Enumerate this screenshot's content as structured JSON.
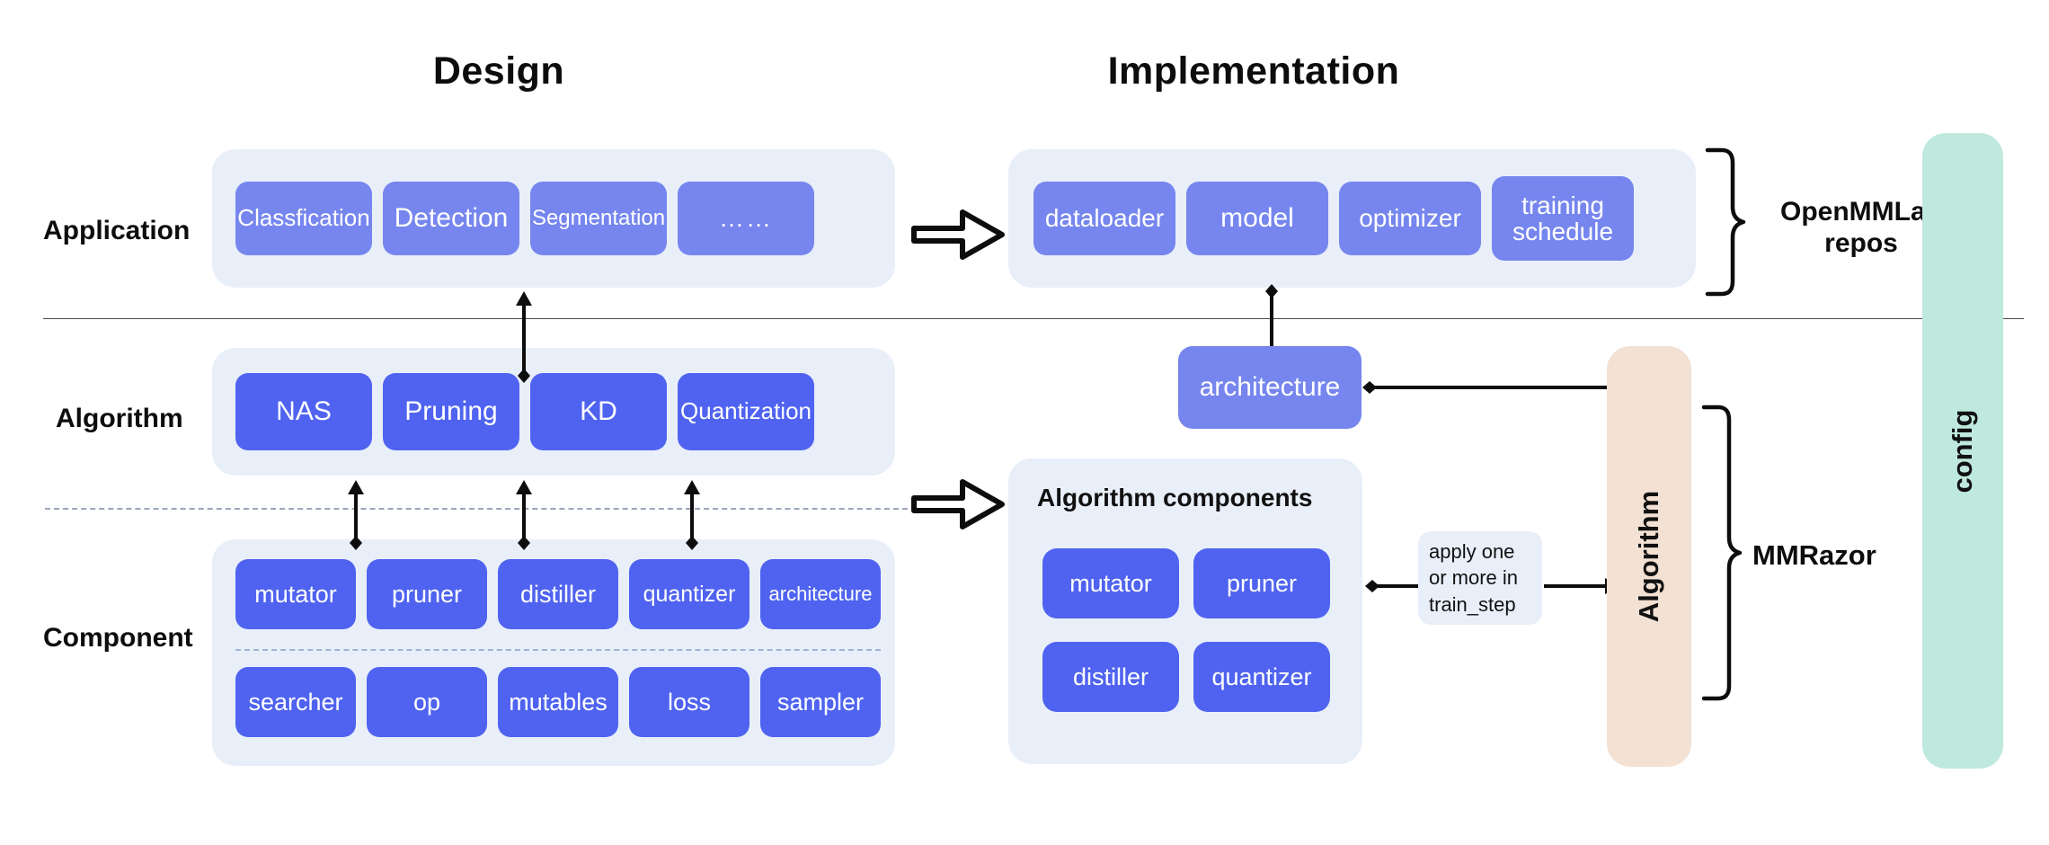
{
  "headings": {
    "design": "Design",
    "implementation": "Implementation"
  },
  "rows": {
    "application": "Application",
    "algorithm": "Algorithm",
    "component": "Component"
  },
  "design": {
    "application_items": [
      "Classfication",
      "Detection",
      "Segmentation",
      "……"
    ],
    "algorithm_items": [
      "NAS",
      "Pruning",
      "KD",
      "Quantization"
    ],
    "component_items_row1": [
      "mutator",
      "pruner",
      "distiller",
      "quantizer",
      "architecture"
    ],
    "component_items_row2": [
      "searcher",
      "op",
      "mutables",
      "loss",
      "sampler"
    ]
  },
  "implementation": {
    "application_items": [
      "dataloader",
      "model",
      "optimizer",
      "training schedule"
    ],
    "architecture_label": "architecture",
    "components_panel_title": "Algorithm components",
    "component_items": [
      "mutator",
      "pruner",
      "distiller",
      "quantizer"
    ],
    "apply_note": "apply one or more in train_step",
    "apply_note_lines": [
      "apply one",
      "or more in",
      "train_step"
    ]
  },
  "annotations": {
    "openmmlab_repos": "OpenMMLab repos",
    "openmmlab_repos_lines": [
      "OpenMMLab",
      "repos"
    ],
    "mmrazor": "MMRazor",
    "algorithm_bar": "Algorithm",
    "config_bar": "config"
  },
  "colors": {
    "chip_light": "#7686ee",
    "chip_dark": "#4f63f0",
    "panel_bg": "#e9eff9",
    "algorithm_bar_bg": "#f3e1d3",
    "config_bar_bg": "#bfe9de",
    "line": "#4a4a4a",
    "dash": "#9aa6bb"
  },
  "icons": {
    "flow_arrow": "block-arrow-right-icon",
    "link_arrow": "diamond-arrow-icon",
    "brace": "curly-brace-icon"
  }
}
